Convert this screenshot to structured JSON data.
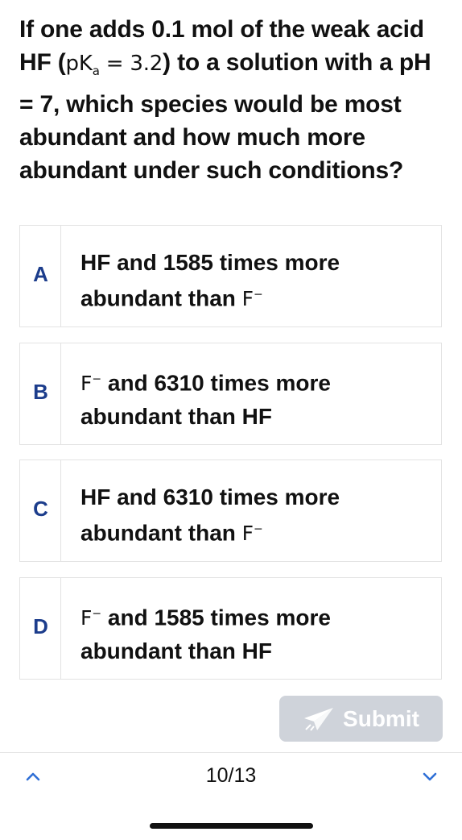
{
  "question": {
    "part1": "If one adds 0.1 mol of the weak acid HF (",
    "pka_p": "p",
    "pka_k": "K",
    "pka_sub": "a",
    "pka_rest": " = 3.2",
    "part2": ") to a solution with a pH = 7, which species would be most abundant and how much more abundant under such conditions?"
  },
  "options": [
    {
      "letter": "A",
      "pre": "HF and 1585 times more abundant than ",
      "ion": "F",
      "ion_sup": "−",
      "post": ""
    },
    {
      "letter": "B",
      "pre": "",
      "ion": "F",
      "ion_sup": "−",
      "post": " and 6310 times more abundant than HF"
    },
    {
      "letter": "C",
      "pre": "HF and  6310 times more abundant than ",
      "ion": "F",
      "ion_sup": "−",
      "post": ""
    },
    {
      "letter": "D",
      "pre": "",
      "ion": "F",
      "ion_sup": "−",
      "post": " and 1585 times more abundant than HF"
    }
  ],
  "submit": {
    "label": "Submit",
    "icon": "send-icon",
    "enabled": false
  },
  "navigation": {
    "counter": "10/13",
    "prev_icon": "chevron-up-icon",
    "next_icon": "chevron-down-icon"
  },
  "colors": {
    "accent": "#1c3d8c",
    "submit_disabled_bg": "#cfd3da",
    "border": "#e3e3e3",
    "nav_arrow": "#2f6fd6"
  }
}
